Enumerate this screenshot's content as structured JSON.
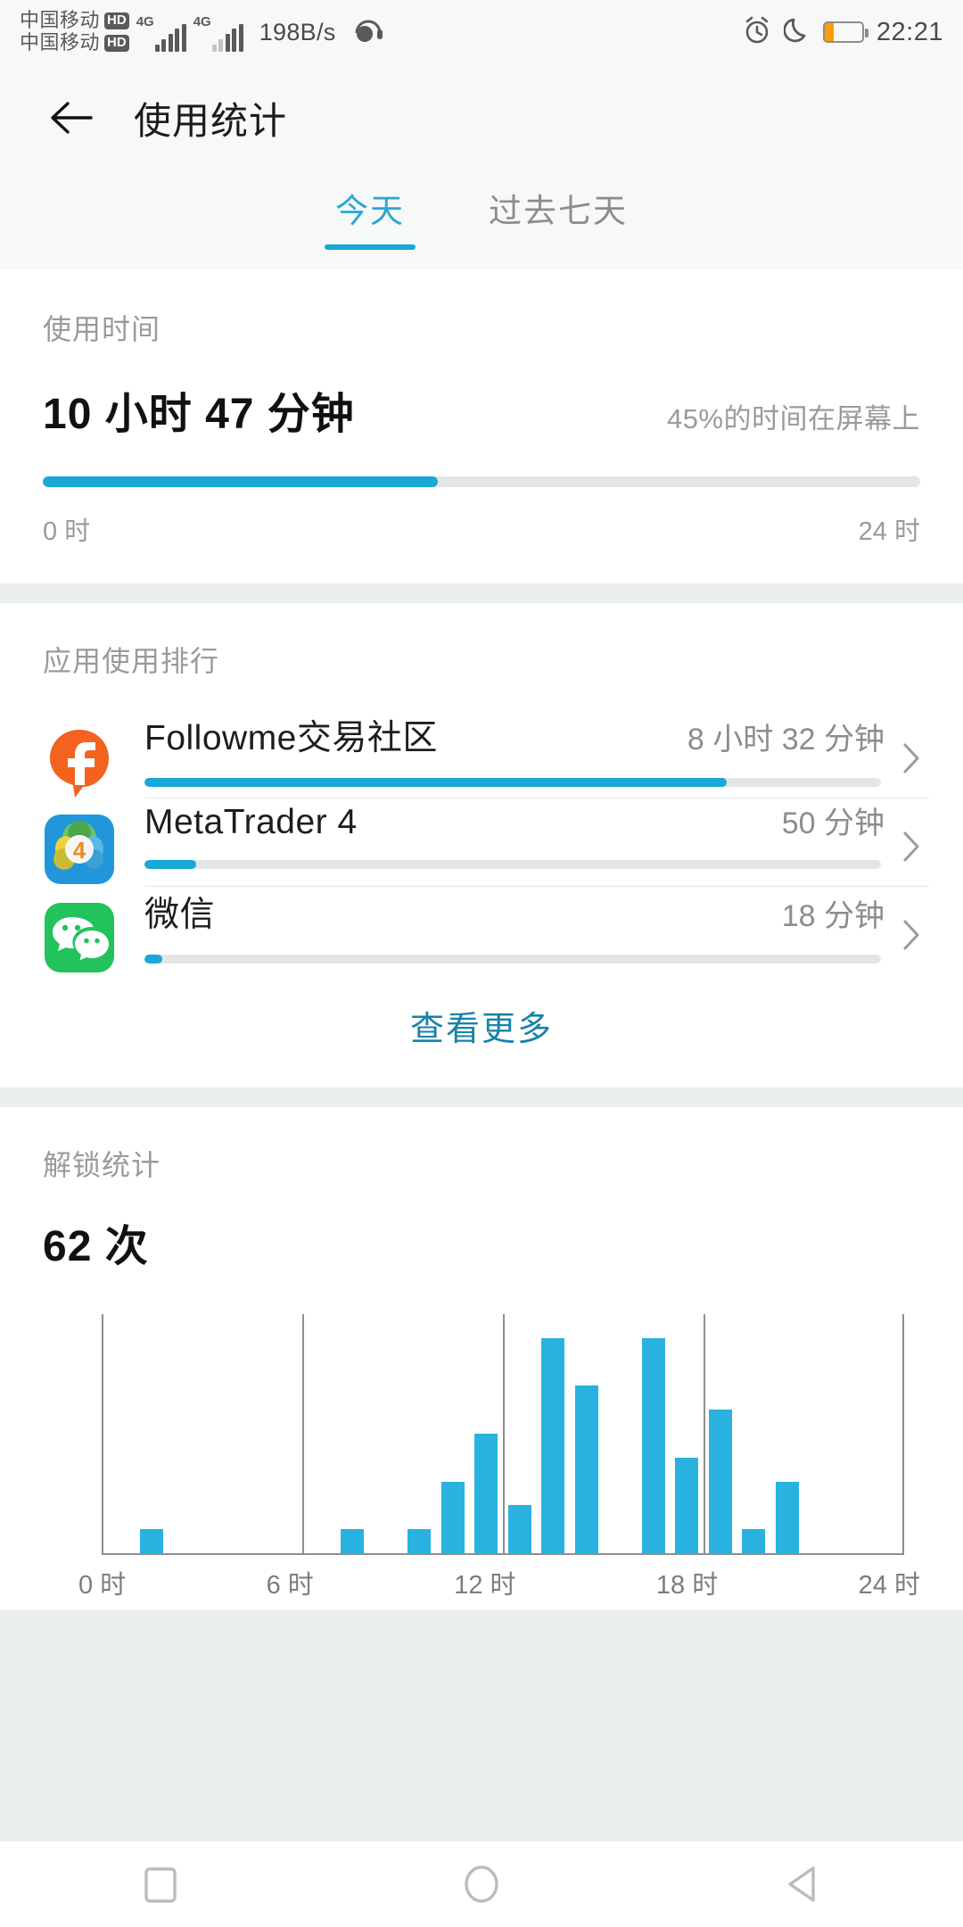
{
  "status_bar": {
    "carrier_line1": "中国移动",
    "carrier_line2": "中国移动",
    "hd_badge": "HD",
    "network_label_1": "4G",
    "network_label_2": "4G",
    "net_speed": "198B/s",
    "time": "22:21",
    "battery_percent": 25,
    "icons": [
      "headset-icon",
      "alarm-icon",
      "moon-icon",
      "battery-icon"
    ]
  },
  "app_bar": {
    "back_icon": "back-arrow-icon",
    "title": "使用统计"
  },
  "tabs": [
    {
      "label": "今天",
      "active": true
    },
    {
      "label": "过去七天",
      "active": false
    }
  ],
  "usage_time": {
    "section_label": "使用时间",
    "duration": "10 小时 47 分钟",
    "percent_note": "45%的时间在屏幕上",
    "progress_percent": 45,
    "scale_start": "0 时",
    "scale_end": "24 时",
    "accent_color": "#17a8d6"
  },
  "app_ranking": {
    "section_label": "应用使用排行",
    "more_label": "查看更多",
    "apps": [
      {
        "name": "Followme交易社区",
        "duration": "8 小时 32 分钟",
        "bar_percent": 79,
        "icon": "followme-icon"
      },
      {
        "name": "MetaTrader 4",
        "duration": "50 分钟",
        "bar_percent": 7,
        "icon": "metatrader4-icon"
      },
      {
        "name": "微信",
        "duration": "18 分钟",
        "bar_percent": 2.4,
        "icon": "wechat-icon"
      }
    ]
  },
  "unlock_stats": {
    "section_label": "解锁统计",
    "count": "62 次"
  },
  "chart_data": {
    "type": "bar",
    "title": "解锁统计",
    "xlabel": "",
    "ylabel": "",
    "grid": true,
    "legend": "none",
    "categories": [
      "0",
      "1",
      "2",
      "3",
      "4",
      "5",
      "6",
      "7",
      "8",
      "9",
      "10",
      "11",
      "12",
      "13",
      "14",
      "15",
      "16",
      "17",
      "18",
      "19",
      "20",
      "21",
      "22",
      "23"
    ],
    "tick_labels": [
      "0 时",
      "6 时",
      "12 时",
      "18 时",
      "24 时"
    ],
    "tick_positions": [
      0,
      6,
      12,
      18,
      24
    ],
    "values": [
      0,
      1,
      0,
      0,
      0,
      0,
      0,
      1,
      0,
      1,
      3,
      5,
      2,
      9,
      7,
      0,
      9,
      4,
      6,
      1,
      3,
      0,
      0,
      0
    ],
    "ylim": [
      0,
      10
    ],
    "bar_color": "#29b2e0"
  },
  "nav_bar": {
    "recent_icon": "square-recents-icon",
    "home_icon": "circle-home-icon",
    "back_icon": "triangle-back-icon"
  }
}
